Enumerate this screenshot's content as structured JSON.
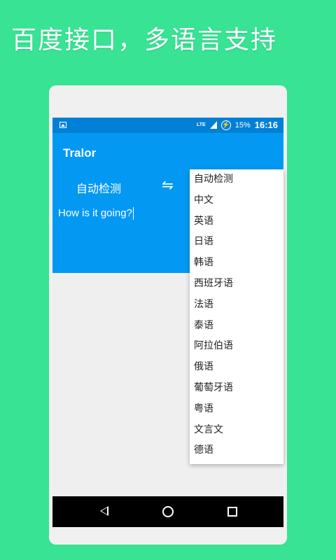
{
  "headline": "百度接口，多语言支持",
  "status_bar": {
    "lte": "LTE",
    "battery_percent": "15%",
    "time": "16:16"
  },
  "app": {
    "title": "Tralor",
    "source_language": "自动检测",
    "swap_symbol": "⇋",
    "input_text": "How is it going?"
  },
  "dropdown": {
    "options": [
      "自动检测",
      "中文",
      "英语",
      "日语",
      "韩语",
      "西班牙语",
      "法语",
      "泰语",
      "阿拉伯语",
      "俄语",
      "葡萄牙语",
      "粤语",
      "文言文",
      "德语"
    ]
  },
  "colors": {
    "background": "#38e394",
    "app_bar": "#0399f3",
    "status_bar": "#0280d5"
  }
}
